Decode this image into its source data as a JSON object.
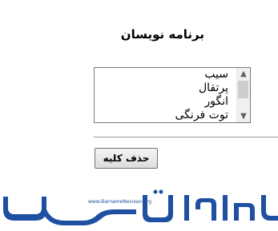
{
  "page": {
    "title": "برنامه نویسان"
  },
  "listbox": {
    "items": [
      "سیب",
      "پرتقال",
      "انگور",
      "توت فرنگی"
    ]
  },
  "actions": {
    "delete_all_label": "حذف کلیه"
  },
  "logo": {
    "text": "برنامه نویسان",
    "url": "www.BarnameNevisan.org",
    "color": "#1f4fa0"
  }
}
